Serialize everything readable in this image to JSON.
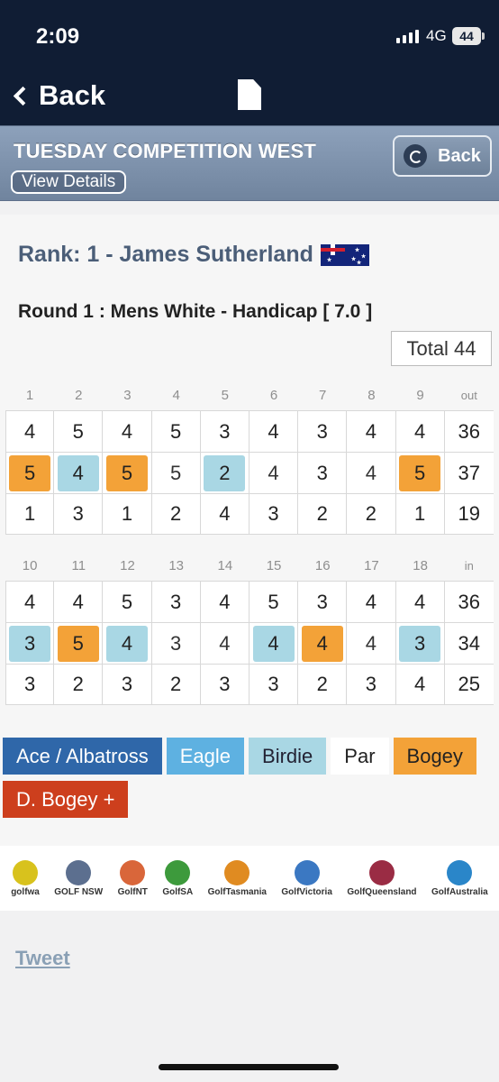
{
  "status": {
    "time": "2:09",
    "network": "4G",
    "battery": "44"
  },
  "nav": {
    "back_label": "Back"
  },
  "header": {
    "title": "TUESDAY COMPETITION WEST",
    "view_details": "View Details",
    "back_label": "Back"
  },
  "player": {
    "rank_text": "Rank: 1 - James Sutherland",
    "round_text": "Round 1 : Mens White - Handicap [ 7.0 ]",
    "total_text": "Total 44"
  },
  "front": {
    "holes": [
      "1",
      "2",
      "3",
      "4",
      "5",
      "6",
      "7",
      "8",
      "9",
      "out"
    ],
    "par": [
      "4",
      "5",
      "4",
      "5",
      "3",
      "4",
      "3",
      "4",
      "4",
      "36"
    ],
    "score": [
      "5",
      "4",
      "5",
      "5",
      "2",
      "4",
      "3",
      "4",
      "5",
      "37"
    ],
    "result": [
      "bogey",
      "birdie",
      "bogey",
      "par",
      "birdie",
      "par",
      "plain",
      "par",
      "bogey",
      "plain"
    ],
    "points": [
      "1",
      "3",
      "1",
      "2",
      "4",
      "3",
      "2",
      "2",
      "1",
      "19"
    ]
  },
  "back": {
    "holes": [
      "10",
      "11",
      "12",
      "13",
      "14",
      "15",
      "16",
      "17",
      "18",
      "in"
    ],
    "par": [
      "4",
      "4",
      "5",
      "3",
      "4",
      "5",
      "3",
      "4",
      "4",
      "36"
    ],
    "score": [
      "3",
      "5",
      "4",
      "3",
      "4",
      "4",
      "4",
      "4",
      "3",
      "34"
    ],
    "result": [
      "birdie",
      "bogey",
      "birdie",
      "par",
      "par",
      "birdie",
      "bogey",
      "par",
      "birdie",
      "plain"
    ],
    "points": [
      "3",
      "2",
      "3",
      "2",
      "3",
      "3",
      "2",
      "3",
      "4",
      "25"
    ]
  },
  "legend": {
    "ace": "Ace / Albatross",
    "eagle": "Eagle",
    "birdie": "Birdie",
    "par": "Par",
    "bogey": "Bogey",
    "dbogey": "D. Bogey +"
  },
  "partners": [
    {
      "name": "golfwa",
      "color": "#d8c21d"
    },
    {
      "name": "GOLF NSW",
      "color": "#5c6f8f"
    },
    {
      "name": "GolfNT",
      "color": "#d9663a"
    },
    {
      "name": "GolfSA",
      "color": "#3d9a3c"
    },
    {
      "name": "GolfTasmania",
      "color": "#e08b21"
    },
    {
      "name": "GolfVictoria",
      "color": "#3b78c2"
    },
    {
      "name": "GolfQueensland",
      "color": "#9a2c44"
    },
    {
      "name": "GolfAustralia",
      "color": "#2a86c9"
    }
  ],
  "tweet": "Tweet"
}
